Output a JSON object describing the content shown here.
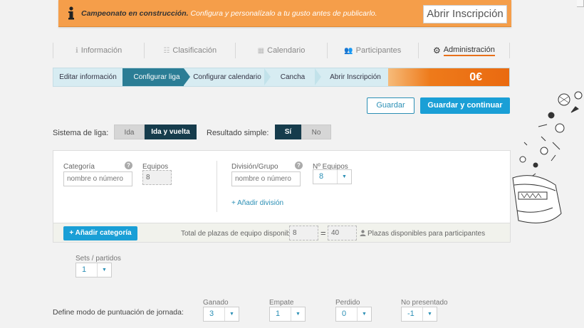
{
  "banner": {
    "bold_text": "Campeonato en construcción.",
    "text": "Configura y personalízalo a tu gusto antes de publicarlo.",
    "button": "Abrir Inscripción"
  },
  "tabs": [
    {
      "label": "Información",
      "icon": "info-icon"
    },
    {
      "label": "Clasificación",
      "icon": "list-icon"
    },
    {
      "label": "Calendario",
      "icon": "calendar-icon"
    },
    {
      "label": "Participantes",
      "icon": "users-icon"
    },
    {
      "label": "Administración",
      "icon": "gear-icon",
      "active": true
    }
  ],
  "steps": [
    {
      "label": "Editar información"
    },
    {
      "label": "Configurar liga",
      "active": true
    },
    {
      "label": "Configurar calendario"
    },
    {
      "label": "Cancha"
    },
    {
      "label": "Abrir Inscripción"
    }
  ],
  "price": "0€",
  "actions": {
    "save": "Guardar",
    "save_continue": "Guardar y continuar"
  },
  "league_system": {
    "label": "Sistema de liga:",
    "options": [
      "Ida",
      "Ida y vuelta"
    ],
    "selected": "Ida y vuelta"
  },
  "simple_result": {
    "label": "Resultado simple:",
    "options": [
      "Sí",
      "No"
    ],
    "selected": "Sí"
  },
  "category": {
    "label": "Categoría",
    "placeholder": "nombre o número",
    "teams_label": "Equipos",
    "teams_value": "8"
  },
  "division": {
    "label": "División/Grupo",
    "placeholder": "nombre o número",
    "teams_label": "Nº Equipos",
    "teams_value": "8",
    "add_link": "+ Añadir división"
  },
  "footer": {
    "add_category": "+ Añadir categoría",
    "total_label": "Total de plazas de equipo disponibles:",
    "total_value": "8",
    "equals": "=",
    "available_value": "40",
    "available_label": "Plazas disponibles para participantes"
  },
  "sets": {
    "label": "Sets / partidos",
    "value": "1"
  },
  "scoring": {
    "label": "Define modo de puntuación de jornada:",
    "won": {
      "label": "Ganado",
      "value": "3"
    },
    "draw": {
      "label": "Empate",
      "value": "1"
    },
    "lost": {
      "label": "Perdido",
      "value": "0"
    },
    "no_show": {
      "label": "No presentado",
      "value": "-1"
    }
  },
  "colors": {
    "banner": "#f59e4a",
    "step_active": "#2b7d95",
    "primary": "#1a9fd6",
    "toggle_on": "#163c4c",
    "accent_orange": "#ea6a10"
  }
}
